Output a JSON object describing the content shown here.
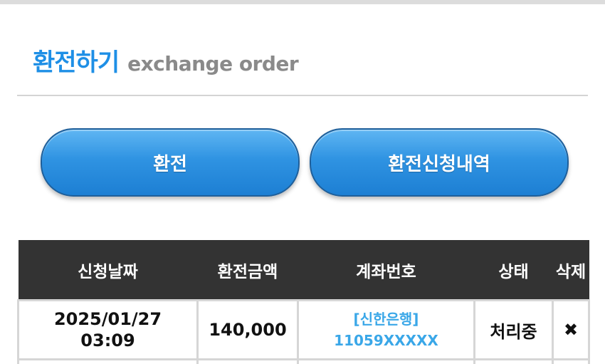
{
  "header": {
    "title": "환전하기",
    "subtitle": "exchange order"
  },
  "buttons": {
    "exchange_label": "환전",
    "history_label": "환전신청내역"
  },
  "table": {
    "columns": [
      "신청날짜",
      "환전금액",
      "계좌번호",
      "상태",
      "삭제"
    ],
    "rows": [
      {
        "date": "2025/01/27",
        "time": "03:09",
        "amount": "140,000",
        "bank": "[신한은행]",
        "account": "11059XXXXX",
        "status": "처리중",
        "delete_icon": "✖"
      }
    ]
  },
  "colors": {
    "accent": "#1e8fe6",
    "header_bg": "#333333",
    "link": "#3aa7e8"
  }
}
